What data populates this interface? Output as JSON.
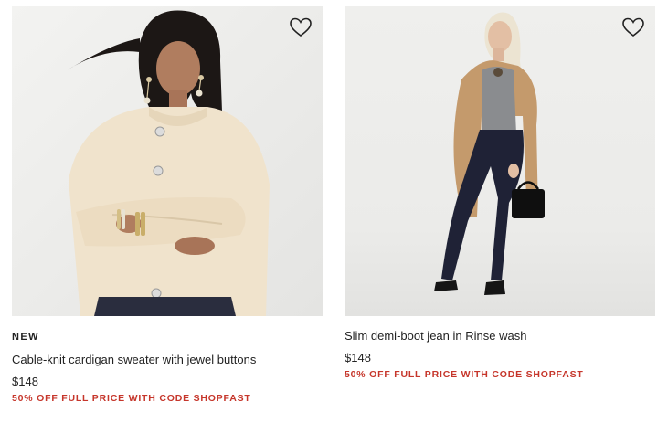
{
  "products": [
    {
      "badge": "NEW",
      "name": "Cable-knit cardigan sweater with jewel buttons",
      "price": "$148",
      "promo": "50% OFF FULL PRICE WITH CODE SHOPFAST",
      "wishlist_icon": "heart-outline-icon"
    },
    {
      "badge": "",
      "name": "Slim demi-boot jean in Rinse wash",
      "price": "$148",
      "promo": "50% OFF FULL PRICE WITH CODE SHOPFAST",
      "wishlist_icon": "heart-outline-icon"
    }
  ],
  "colors": {
    "promo": "#c6362b",
    "text": "#222222",
    "image_bg": "#eeeeec"
  }
}
